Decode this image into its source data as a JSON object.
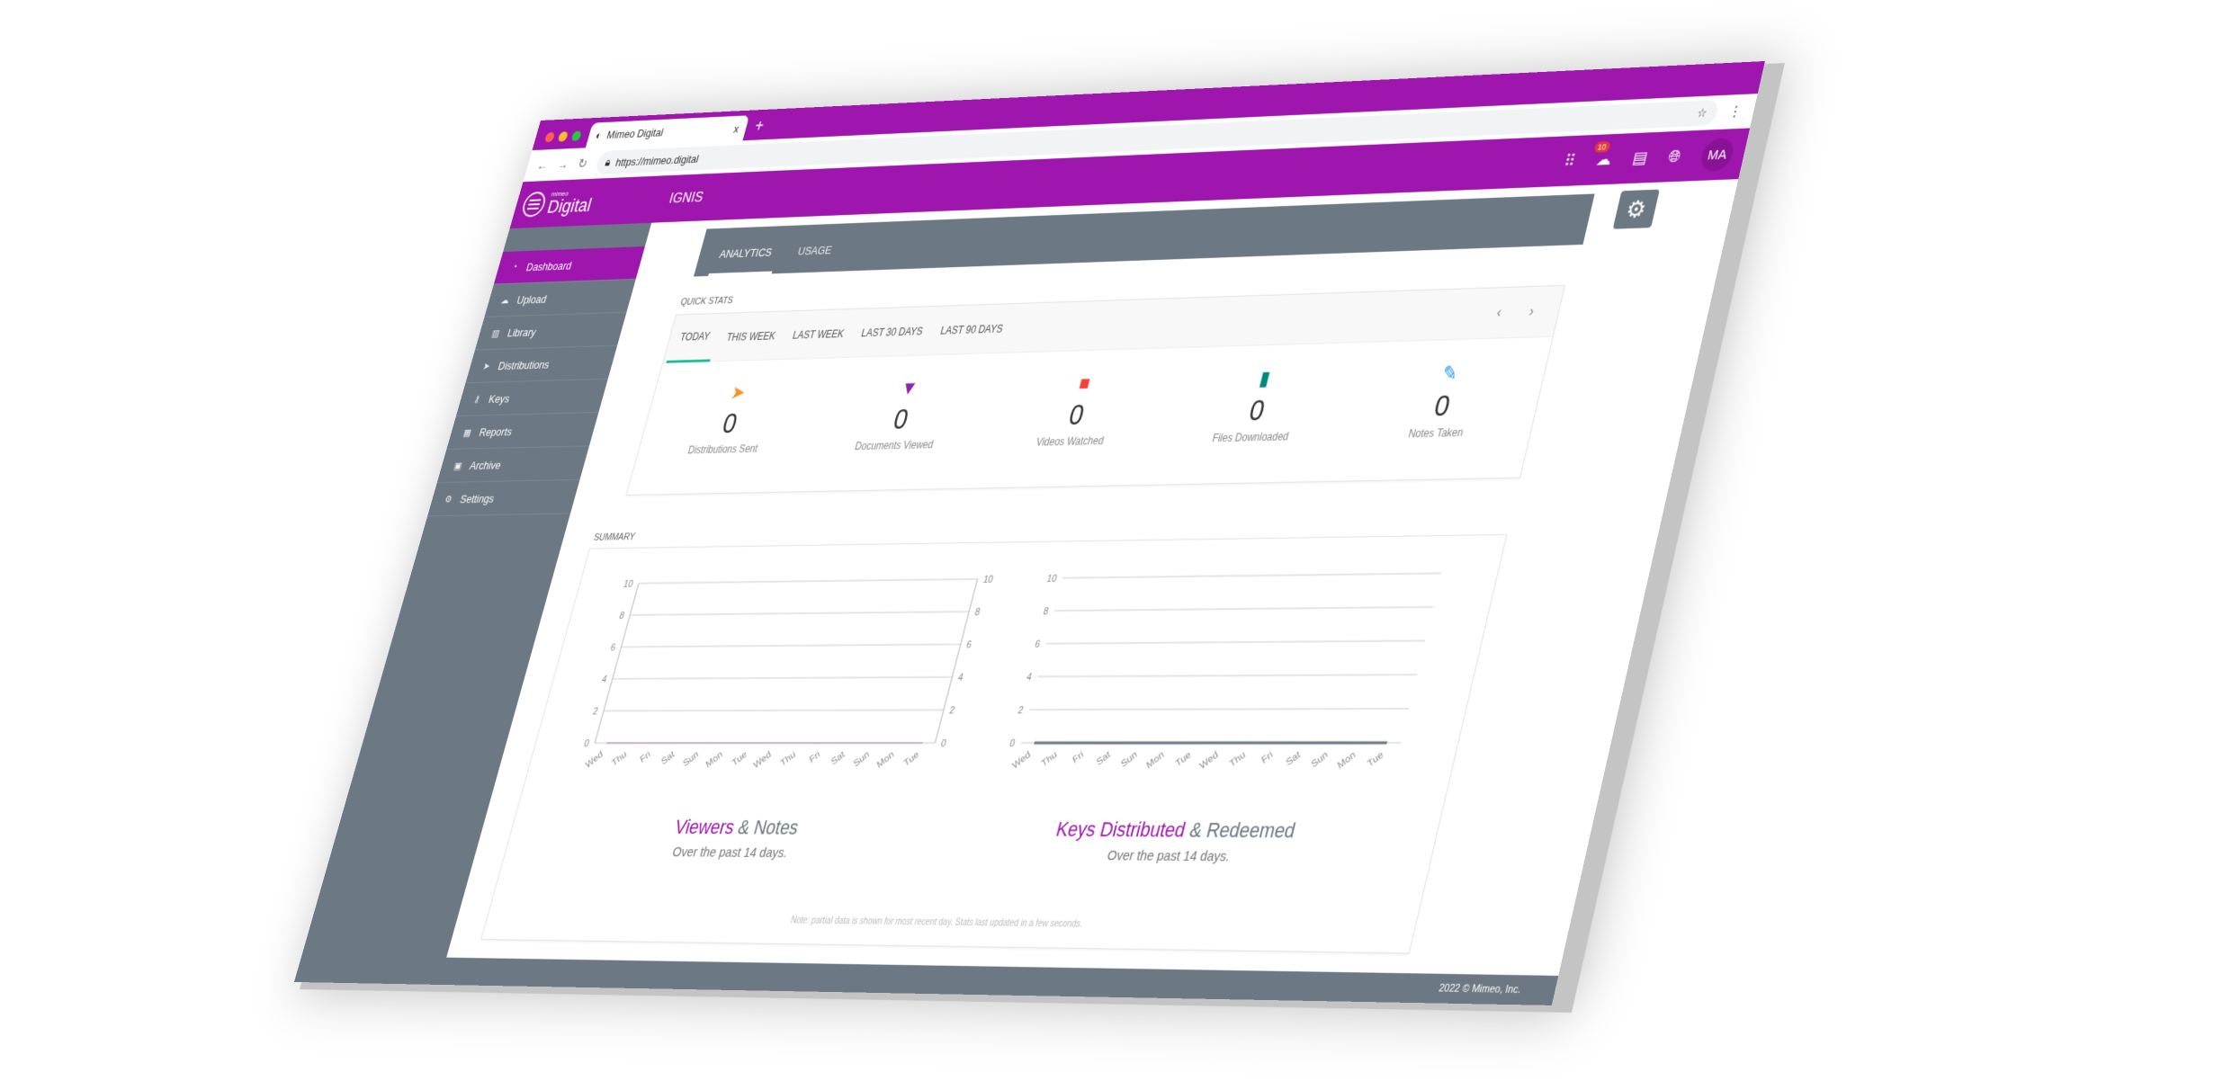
{
  "browser": {
    "tab_title": "Mimeo Digital",
    "url": "https://mimeo.digital",
    "new_tab": "+",
    "close": "x"
  },
  "header": {
    "logo_small": "mimeo",
    "logo_big": "Digital",
    "app_name": "IGNIS",
    "notification_count": "10",
    "avatar": "MA"
  },
  "sidebar": {
    "items": [
      {
        "label": "Dashboard",
        "icon": "gauge-icon",
        "active": true
      },
      {
        "label": "Upload",
        "icon": "cloud-upload-icon"
      },
      {
        "label": "Library",
        "icon": "book-icon"
      },
      {
        "label": "Distributions",
        "icon": "paper-plane-icon"
      },
      {
        "label": "Keys",
        "icon": "key-icon"
      },
      {
        "label": "Reports",
        "icon": "bar-chart-icon"
      },
      {
        "label": "Archive",
        "icon": "archive-icon"
      },
      {
        "label": "Settings",
        "icon": "gear-icon"
      }
    ]
  },
  "main": {
    "tabs": [
      {
        "label": "ANALYTICS",
        "active": true
      },
      {
        "label": "USAGE"
      }
    ],
    "quick_stats_label": "QUICK STATS",
    "periods": [
      "TODAY",
      "THIS WEEK",
      "LAST WEEK",
      "LAST 30 DAYS",
      "LAST 90 DAYS"
    ],
    "stats": [
      {
        "value": "0",
        "label": "Distributions Sent",
        "icon": "paper-plane-icon",
        "color": "#f7931e"
      },
      {
        "value": "0",
        "label": "Documents Viewed",
        "icon": "bookmark-icon",
        "color": "#8e24aa"
      },
      {
        "value": "0",
        "label": "Videos Watched",
        "icon": "video-camera-icon",
        "color": "#f44336"
      },
      {
        "value": "0",
        "label": "Files Downloaded",
        "icon": "file-icon",
        "color": "#00897b"
      },
      {
        "value": "0",
        "label": "Notes Taken",
        "icon": "pencil-icon",
        "color": "#2196f3"
      }
    ],
    "summary_label": "SUMMARY",
    "charts": [
      {
        "title_highlight": "Viewers",
        "title_rest": "& Notes",
        "subtitle": "Over the past 14 days."
      },
      {
        "title_highlight": "Keys Distributed",
        "title_rest": "& Redeemed",
        "subtitle": "Over the past 14 days."
      }
    ],
    "note": "Note: partial data is shown for most recent day. Stats last updated in a few seconds."
  },
  "footer": "2022 © Mimeo, Inc.",
  "colors": {
    "brand": "#9e16ad",
    "sidebar": "#6c7883",
    "accent": "#1abc9c"
  },
  "chart_data": [
    {
      "type": "line",
      "categories": [
        "Wed",
        "Thu",
        "Fri",
        "Sat",
        "Sun",
        "Mon",
        "Tue",
        "Wed",
        "Thu",
        "Fri",
        "Sat",
        "Sun",
        "Mon",
        "Tue"
      ],
      "series": [
        {
          "values": [
            0,
            0,
            0,
            0,
            0,
            0,
            0,
            0,
            0,
            0,
            0,
            0,
            0,
            0
          ]
        },
        {
          "values": [
            0,
            0,
            0,
            0,
            0,
            0,
            0,
            0,
            0,
            0,
            0,
            0,
            0,
            0
          ]
        }
      ],
      "ylim": [
        0,
        10
      ],
      "yticks": [
        0,
        2,
        4,
        6,
        8,
        10
      ],
      "y2lim": [
        0,
        10
      ],
      "grid": true
    },
    {
      "type": "line",
      "categories": [
        "Wed",
        "Thu",
        "Fri",
        "Sat",
        "Sun",
        "Mon",
        "Tue",
        "Wed",
        "Thu",
        "Fri",
        "Sat",
        "Sun",
        "Mon",
        "Tue"
      ],
      "series": [
        {
          "values": [
            0,
            0,
            0,
            0,
            0,
            0,
            0,
            0,
            0,
            0,
            0,
            0,
            0,
            0
          ]
        }
      ],
      "ylim": [
        0,
        10
      ],
      "yticks": [
        0,
        2,
        4,
        6,
        8,
        10
      ],
      "grid": true
    }
  ]
}
